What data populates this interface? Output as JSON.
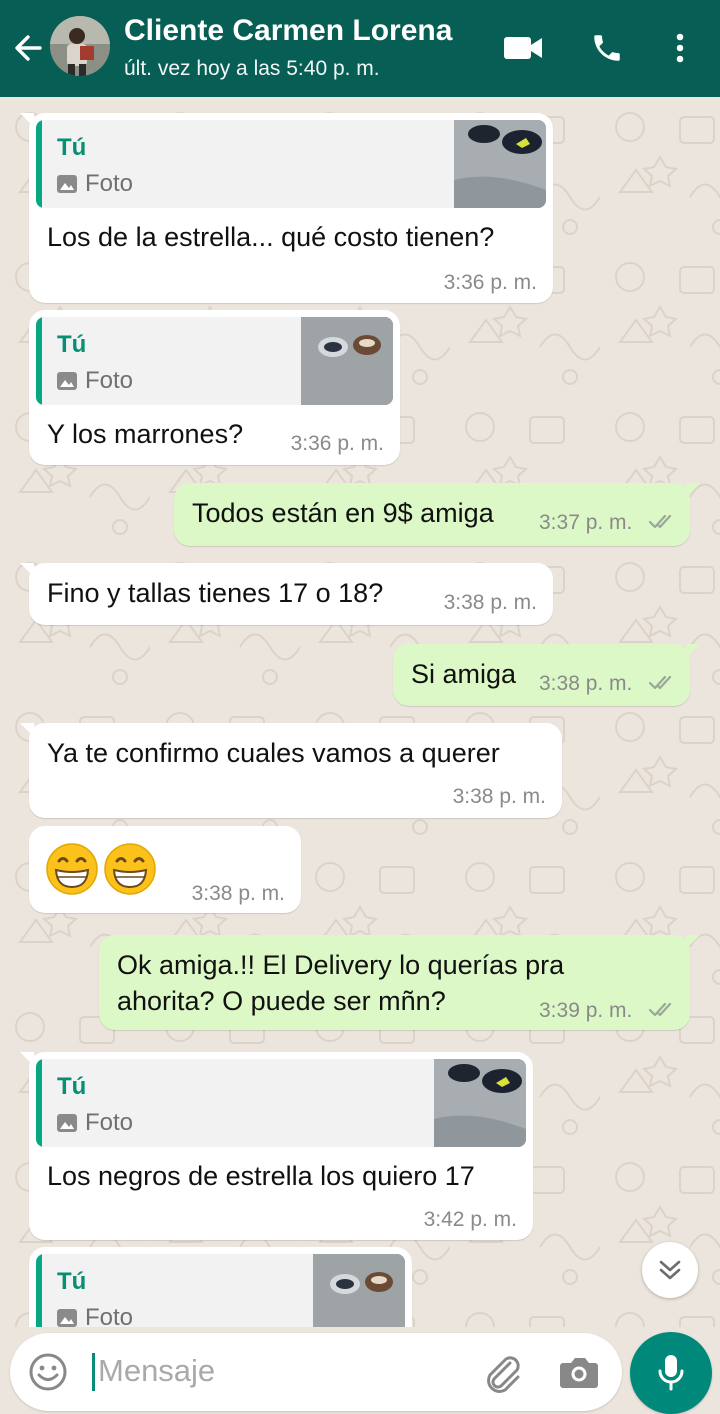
{
  "header": {
    "contact_name": "Cliente Carmen Lorena",
    "status": "últ. vez hoy a las 5:40 p. m.",
    "icons": [
      "back-arrow-icon",
      "video-call-icon",
      "voice-call-icon",
      "more-options-icon"
    ]
  },
  "messages": [
    {
      "direction": "in",
      "quoted": {
        "author": "Tú",
        "type": "Foto"
      },
      "text": "Los de la estrella... qué costo tienen?",
      "time": "3:36 p. m."
    },
    {
      "direction": "in",
      "quoted": {
        "author": "Tú",
        "type": "Foto"
      },
      "text": "Y los marrones?",
      "time": "3:36 p. m."
    },
    {
      "direction": "out",
      "text": "Todos están en 9$ amiga",
      "time": "3:37 p. m.",
      "status": "read"
    },
    {
      "direction": "in",
      "text": "Fino y tallas tienes 17 o 18?",
      "time": "3:38 p. m."
    },
    {
      "direction": "out",
      "text": "Si amiga",
      "time": "3:38 p. m.",
      "status": "read"
    },
    {
      "direction": "in",
      "text": "Ya te confirmo cuales vamos a querer",
      "time": "3:38 p. m."
    },
    {
      "direction": "in",
      "text": "😁😁",
      "time": "3:38 p. m."
    },
    {
      "direction": "out",
      "lines": [
        "Ok amiga.!! El Delivery lo querías pra",
        "ahorita? O puede ser mñn?"
      ],
      "time": "3:39 p. m.",
      "status": "read"
    },
    {
      "direction": "in",
      "quoted": {
        "author": "Tú",
        "type": "Foto"
      },
      "text": "Los negros de estrella los quiero 17",
      "time": "3:42 p. m."
    },
    {
      "direction": "in",
      "quoted": {
        "author": "Tú",
        "type": "Foto"
      }
    }
  ],
  "composer": {
    "placeholder": "Mensaje"
  },
  "colors": {
    "header": "#075E54",
    "outgoing_bubble": "#DCF8C6",
    "incoming_bubble": "#FFFFFF",
    "chat_background": "#ECE5DD",
    "quote_accent": "#06A884",
    "mic_button": "#00897B",
    "read_ticks": "#9BA79A"
  }
}
